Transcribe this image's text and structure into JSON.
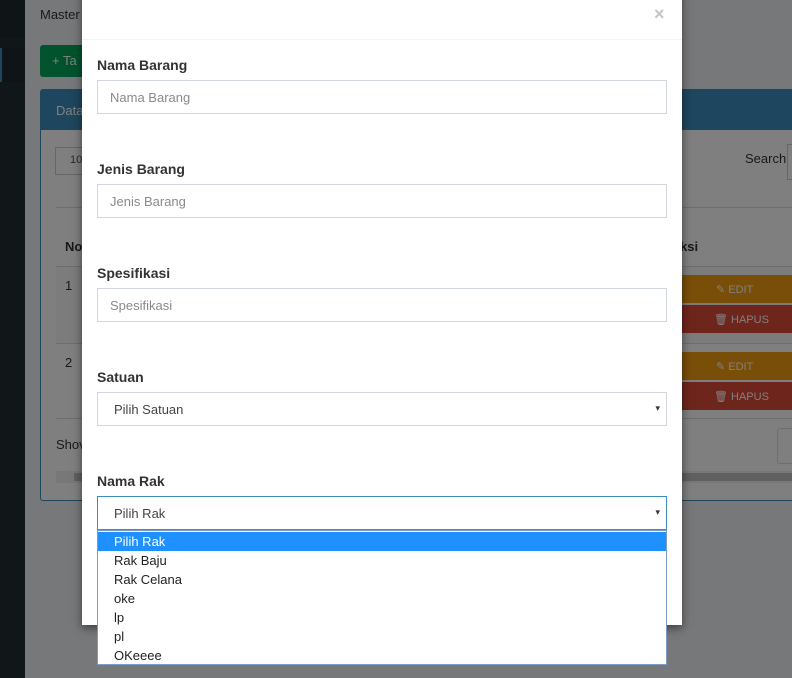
{
  "background": {
    "header_text": "Master",
    "add_button_label": "+ Ta",
    "box_title": "Data",
    "length_value": "10",
    "search_label": "Search:",
    "table": {
      "col_no": "No",
      "col_aksi": "ksi",
      "rows": [
        {
          "no": "1",
          "edit_label": "EDIT",
          "delete_label": "HAPUS"
        },
        {
          "no": "2",
          "edit_label": "EDIT",
          "delete_label": "HAPUS"
        }
      ]
    },
    "show_text": "Shov"
  },
  "modal": {
    "title": "",
    "close_glyph": "×",
    "fields": {
      "nama_barang": {
        "label": "Nama Barang",
        "placeholder": "Nama Barang",
        "value": ""
      },
      "jenis_barang": {
        "label": "Jenis Barang",
        "placeholder": "Jenis Barang",
        "value": ""
      },
      "spesifikasi": {
        "label": "Spesifikasi",
        "placeholder": "Spesifikasi",
        "value": ""
      },
      "satuan": {
        "label": "Satuan",
        "selected": "Pilih Satuan"
      },
      "nama_rak": {
        "label": "Nama Rak",
        "selected": "Pilih Rak",
        "options": [
          "Pilih Rak",
          "Rak Baju",
          "Rak Celana",
          "oke",
          "lp",
          "pl",
          "OKeeee"
        ]
      }
    },
    "select_arrow_glyph": "▾"
  },
  "colors": {
    "overlay": "rgba(0,0,0,0.5)",
    "primary": "#3c8dbc",
    "success": "#00a65a",
    "warning": "#f39c12",
    "danger": "#dd4b39",
    "option_highlight": "#1e90ff"
  }
}
